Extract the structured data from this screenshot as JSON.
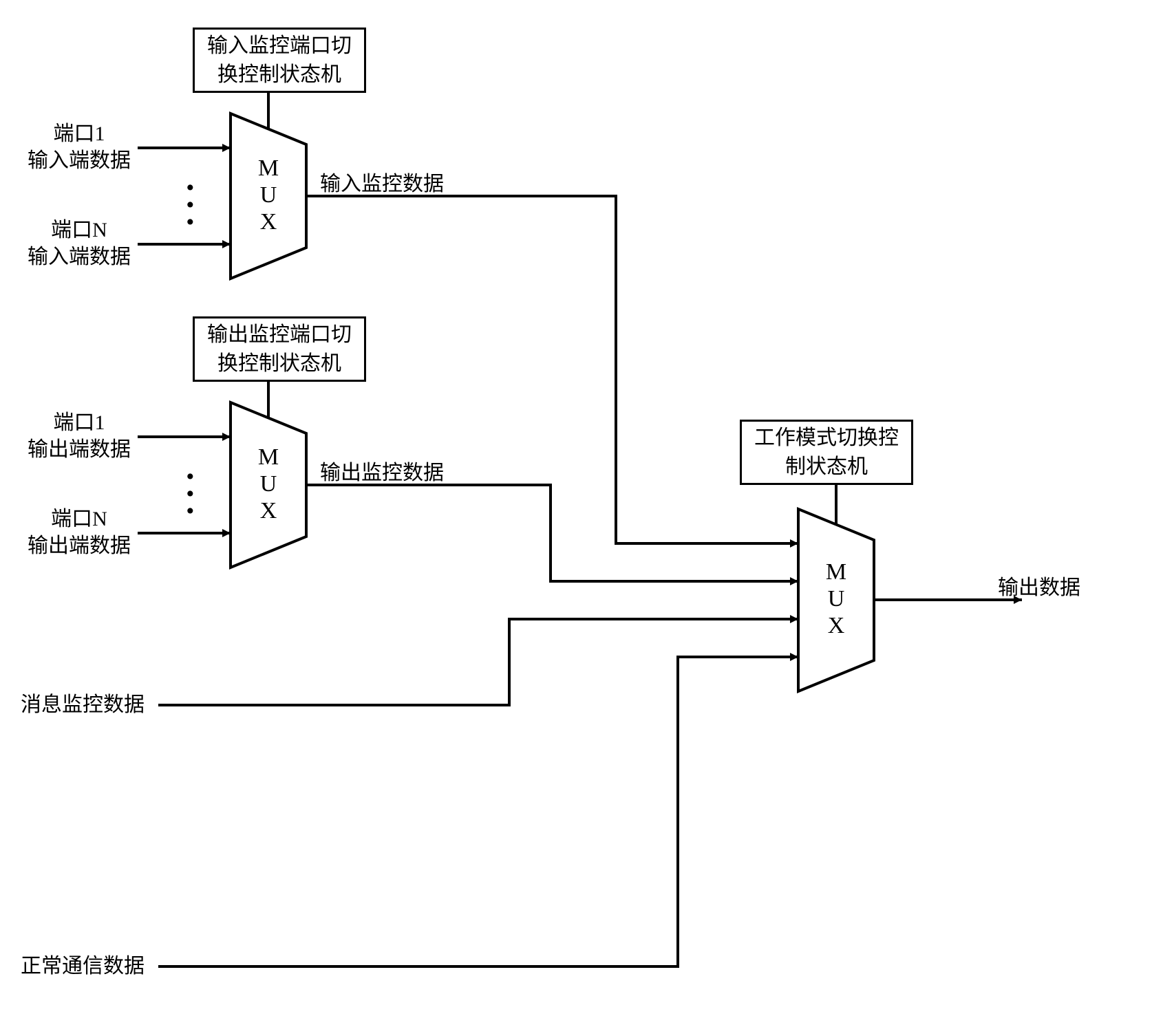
{
  "boxes": {
    "input_fsm": "输入监控端口切\n换控制状态机",
    "output_fsm": "输出监控端口切\n换控制状态机",
    "mode_fsm": "工作模式切换控\n制状态机"
  },
  "mux_label": "M\nU\nX",
  "inputs": {
    "port1_in_line1": "端口1",
    "port1_in_line2": "输入端数据",
    "portN_in_line1": "端口N",
    "portN_in_line2": "输入端数据",
    "port1_out_line1": "端口1",
    "port1_out_line2": "输出端数据",
    "portN_out_line1": "端口N",
    "portN_out_line2": "输出端数据",
    "msg_monitor": "消息监控数据",
    "normal_comm": "正常通信数据"
  },
  "signals": {
    "input_monitor": "输入监控数据",
    "output_monitor": "输出监控数据",
    "output_data": "输出数据"
  }
}
